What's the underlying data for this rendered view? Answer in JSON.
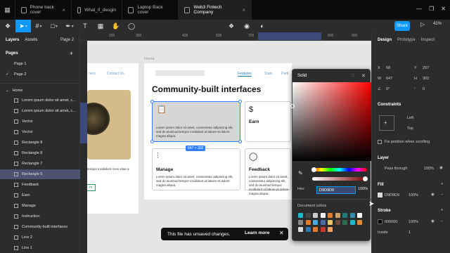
{
  "tabs": [
    {
      "label": "Phone back cover"
    },
    {
      "label": "What_if_desgin"
    },
    {
      "label": "Laptop Back cover"
    },
    {
      "label": "Web3 Fintech Company"
    }
  ],
  "toolbar": {
    "share": "Share",
    "zoom": "41%"
  },
  "left": {
    "tab_layers": "Layers",
    "tab_assets": "Assets",
    "page_select": "Page 2",
    "pages_title": "Pages",
    "pages": [
      "Page 1",
      "Page 2"
    ],
    "frame": "Home",
    "layers": [
      "Lorem ipsum dolor sit amet, c...",
      "Lorem ipsum dolor sit amet, c...",
      "Vector",
      "Vector",
      "Rectangle 8",
      "Rectangle 8",
      "Rectangle 7",
      "Rectangle 5",
      "Feedback",
      "Earn",
      "Manage",
      "Instruction",
      "Community-built interfaces",
      "Line 2",
      "Line 1"
    ]
  },
  "ruler": {
    "top": [
      "250",
      "300",
      "400",
      "600",
      "700",
      "800",
      "900"
    ]
  },
  "canvas": {
    "home_label": "Home",
    "nav": [
      "ners",
      "Contact Us",
      "Features",
      "Stats",
      "Parti"
    ],
    "heading": "Community-built interfaces",
    "lorem": "Lorem ipsum dolor sit amet, consectetur adipiscing elit, sed do eiusmod tempor incididunt ut labore et dolore magna aliqua.",
    "cards": {
      "manage": "Manage",
      "earn": "Earn",
      "feedback": "Feedback"
    },
    "left_frame_text": "tempor incididunt rices vitae a",
    "left_frame_btn": "rn",
    "size_badge": "647 × 302"
  },
  "picker": {
    "mode": "Solid",
    "hex_label": "Hex",
    "hex_value": "D9D9D9",
    "alpha": "100%",
    "doc_colors": "Document colors",
    "swatches": [
      "#1fb6c9",
      "#444444",
      "#cccccc",
      "#f1f1f1",
      "#e07b2b",
      "#c9a06a",
      "#1f7a7a",
      "#2a8fb0",
      "#ffffff",
      "#888888",
      "#e07b2b",
      "#4aa8e0",
      "#4d6fa8",
      "#e9c46a",
      "#6a4a3a",
      "#2d6a4f",
      "#1fb6c9",
      "#e08a3a",
      "#d9d9d9",
      "#2e7bb0",
      "#e07b2b",
      "#c0392b",
      "#f4a261"
    ]
  },
  "right": {
    "tab_design": "Design",
    "tab_prototype": "Prototype",
    "tab_inspect": "Inspect",
    "x": "58",
    "y": "297",
    "w": "647",
    "h": "302",
    "rot": "0°",
    "radius": "0",
    "constraints": "Constraints",
    "c_left": "Left",
    "c_top": "Top",
    "fix_scroll": "Fix position when scrolling",
    "layer": "Layer",
    "pass_through": "Pass through",
    "layer_pct": "100%",
    "fill": "Fill",
    "fill_hex": "D9D9D9",
    "fill_pct": "100%",
    "stroke": "Stroke",
    "stroke_hex": "000000",
    "stroke_pct": "100%",
    "stroke_pos": "Inside",
    "stroke_w": "1"
  },
  "toast": {
    "message": "This file has unsaved changes.",
    "learn": "Learn more"
  }
}
